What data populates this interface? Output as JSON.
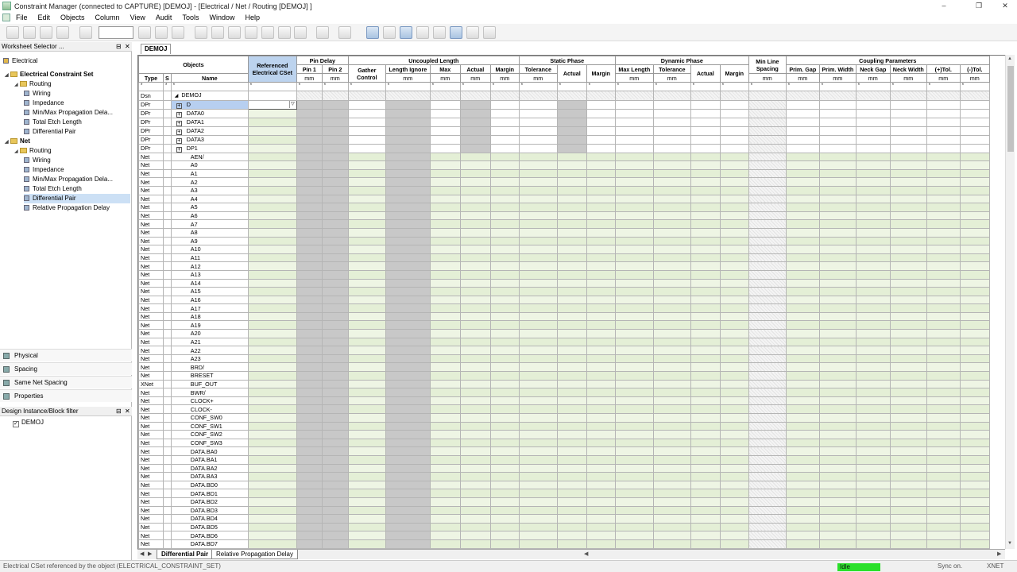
{
  "window": {
    "title": "Constraint Manager (connected to CAPTURE) [DEMOJ] - [Electrical / Net / Routing [DEMOJ] ]",
    "minimize": "–",
    "restore": "❐",
    "close": "✕"
  },
  "menu": [
    "File",
    "Edit",
    "Objects",
    "Column",
    "View",
    "Audit",
    "Tools",
    "Window",
    "Help"
  ],
  "worksheet_selector": {
    "header": "Worksheet Selector ...",
    "pin": "⊟",
    "close": "✕",
    "domain": "Electrical",
    "tree": [
      {
        "label": "Electrical Constraint Set",
        "level": 0,
        "bold": true,
        "kind": "toggle"
      },
      {
        "label": "Routing",
        "level": 1,
        "bold": false,
        "kind": "folder"
      },
      {
        "label": "Wiring",
        "level": 2,
        "bold": false,
        "kind": "leaf"
      },
      {
        "label": "Impedance",
        "level": 2,
        "bold": false,
        "kind": "leaf"
      },
      {
        "label": "Min/Max Propagation Dela...",
        "level": 2,
        "bold": false,
        "kind": "leaf"
      },
      {
        "label": "Total Etch Length",
        "level": 2,
        "bold": false,
        "kind": "leaf"
      },
      {
        "label": "Differential Pair",
        "level": 2,
        "bold": false,
        "kind": "leaf"
      },
      {
        "label": "Net",
        "level": 0,
        "bold": true,
        "kind": "toggle"
      },
      {
        "label": "Routing",
        "level": 1,
        "bold": false,
        "kind": "folder"
      },
      {
        "label": "Wiring",
        "level": 2,
        "bold": false,
        "kind": "leaf"
      },
      {
        "label": "Impedance",
        "level": 2,
        "bold": false,
        "kind": "leaf"
      },
      {
        "label": "Min/Max Propagation Dela...",
        "level": 2,
        "bold": false,
        "kind": "leaf"
      },
      {
        "label": "Total Etch Length",
        "level": 2,
        "bold": false,
        "kind": "leaf"
      },
      {
        "label": "Differential Pair",
        "level": 2,
        "bold": false,
        "kind": "leaf",
        "selected": true
      },
      {
        "label": "Relative Propagation Delay",
        "level": 2,
        "bold": false,
        "kind": "leaf"
      }
    ],
    "nav": [
      "Physical",
      "Spacing",
      "Same Net Spacing",
      "Properties"
    ]
  },
  "design_filter": {
    "header": "Design Instance/Block filter",
    "pin": "⊟",
    "close": "✕",
    "item": "DEMOJ",
    "check": "✓"
  },
  "document_tab": "DEMOJ",
  "grid": {
    "group_headers": {
      "objects": "Objects",
      "ref_cset": "Referenced Electrical CSet",
      "pin_delay": "Pin Delay",
      "uncoupled": "Uncoupled Length",
      "static_phase": "Static Phase",
      "dynamic_phase": "Dynamic Phase",
      "min_line": "Min Line Spacing",
      "coupling": "Coupling Parameters"
    },
    "sub_headers": {
      "type": "Type",
      "s": "S",
      "name": "Name",
      "pin1": "Pin 1",
      "pin2": "Pin 2",
      "gather": "Gather Control",
      "length_ignore": "Length Ignore",
      "max": "Max",
      "actual": "Actual",
      "margin": "Margin",
      "tolerance": "Tolerance",
      "max_length": "Max Length",
      "prim_gap": "Prim. Gap",
      "prim_width": "Prim. Width",
      "neck_gap": "Neck Gap",
      "neck_width": "Neck Width",
      "tol_plus": "(+)Tol.",
      "tol_minus": "(-)Tol."
    },
    "unit": "mm",
    "filter": "*",
    "expand": "+",
    "collapse": "◢",
    "dropdown": "▽",
    "rows": [
      {
        "type": "Dsn",
        "name": "DEMOJ",
        "kind": "root"
      },
      {
        "type": "DPr",
        "name": "D",
        "kind": "dpr",
        "selected": true
      },
      {
        "type": "DPr",
        "name": "DATA0",
        "kind": "dpr"
      },
      {
        "type": "DPr",
        "name": "DATA1",
        "kind": "dpr"
      },
      {
        "type": "DPr",
        "name": "DATA2",
        "kind": "dpr"
      },
      {
        "type": "DPr",
        "name": "DATA3",
        "kind": "dpr"
      },
      {
        "type": "DPr",
        "name": "DP1",
        "kind": "dpr"
      },
      {
        "type": "Net",
        "name": "AEN/",
        "kind": "net"
      },
      {
        "type": "Net",
        "name": "A0",
        "kind": "net"
      },
      {
        "type": "Net",
        "name": "A1",
        "kind": "net"
      },
      {
        "type": "Net",
        "name": "A2",
        "kind": "net"
      },
      {
        "type": "Net",
        "name": "A3",
        "kind": "net"
      },
      {
        "type": "Net",
        "name": "A4",
        "kind": "net"
      },
      {
        "type": "Net",
        "name": "A5",
        "kind": "net"
      },
      {
        "type": "Net",
        "name": "A6",
        "kind": "net"
      },
      {
        "type": "Net",
        "name": "A7",
        "kind": "net"
      },
      {
        "type": "Net",
        "name": "A8",
        "kind": "net"
      },
      {
        "type": "Net",
        "name": "A9",
        "kind": "net"
      },
      {
        "type": "Net",
        "name": "A10",
        "kind": "net"
      },
      {
        "type": "Net",
        "name": "A11",
        "kind": "net"
      },
      {
        "type": "Net",
        "name": "A12",
        "kind": "net"
      },
      {
        "type": "Net",
        "name": "A13",
        "kind": "net"
      },
      {
        "type": "Net",
        "name": "A14",
        "kind": "net"
      },
      {
        "type": "Net",
        "name": "A15",
        "kind": "net"
      },
      {
        "type": "Net",
        "name": "A16",
        "kind": "net"
      },
      {
        "type": "Net",
        "name": "A17",
        "kind": "net"
      },
      {
        "type": "Net",
        "name": "A18",
        "kind": "net"
      },
      {
        "type": "Net",
        "name": "A19",
        "kind": "net"
      },
      {
        "type": "Net",
        "name": "A20",
        "kind": "net"
      },
      {
        "type": "Net",
        "name": "A21",
        "kind": "net"
      },
      {
        "type": "Net",
        "name": "A22",
        "kind": "net"
      },
      {
        "type": "Net",
        "name": "A23",
        "kind": "net"
      },
      {
        "type": "Net",
        "name": "BRD/",
        "kind": "net"
      },
      {
        "type": "Net",
        "name": "BRESET",
        "kind": "net"
      },
      {
        "type": "XNet",
        "name": "BUF_OUT",
        "kind": "net"
      },
      {
        "type": "Net",
        "name": "BWR/",
        "kind": "net"
      },
      {
        "type": "Net",
        "name": "CLOCK+",
        "kind": "net"
      },
      {
        "type": "Net",
        "name": "CLOCK-",
        "kind": "net"
      },
      {
        "type": "Net",
        "name": "CONF_SW0",
        "kind": "net"
      },
      {
        "type": "Net",
        "name": "CONF_SW1",
        "kind": "net"
      },
      {
        "type": "Net",
        "name": "CONF_SW2",
        "kind": "net"
      },
      {
        "type": "Net",
        "name": "CONF_SW3",
        "kind": "net"
      },
      {
        "type": "Net",
        "name": "DATA.BA0",
        "kind": "net"
      },
      {
        "type": "Net",
        "name": "DATA.BA1",
        "kind": "net"
      },
      {
        "type": "Net",
        "name": "DATA.BA2",
        "kind": "net"
      },
      {
        "type": "Net",
        "name": "DATA.BA3",
        "kind": "net"
      },
      {
        "type": "Net",
        "name": "DATA.BD0",
        "kind": "net"
      },
      {
        "type": "Net",
        "name": "DATA.BD1",
        "kind": "net"
      },
      {
        "type": "Net",
        "name": "DATA.BD2",
        "kind": "net"
      },
      {
        "type": "Net",
        "name": "DATA.BD3",
        "kind": "net"
      },
      {
        "type": "Net",
        "name": "DATA.BD4",
        "kind": "net"
      },
      {
        "type": "Net",
        "name": "DATA.BD5",
        "kind": "net"
      },
      {
        "type": "Net",
        "name": "DATA.BD6",
        "kind": "net"
      },
      {
        "type": "Net",
        "name": "DATA.BD7",
        "kind": "net"
      }
    ]
  },
  "sheet_tabs": [
    "Differential Pair",
    "Relative Propagation Delay"
  ],
  "sheet_nav": {
    "prev": "◀",
    "next": "▶"
  },
  "scroll": {
    "up": "▲",
    "down": "▼",
    "left": "◀",
    "right": "▶"
  },
  "status": {
    "message": "Electrical CSet referenced by the object (ELECTRICAL_CONSTRAINT_SET)",
    "state": "Idle",
    "sync": "Sync on.",
    "mode": "XNET"
  },
  "colors": {
    "idle": "#2be02b",
    "ref_header": "#bcd3ee",
    "selection": "#b7cff0"
  }
}
